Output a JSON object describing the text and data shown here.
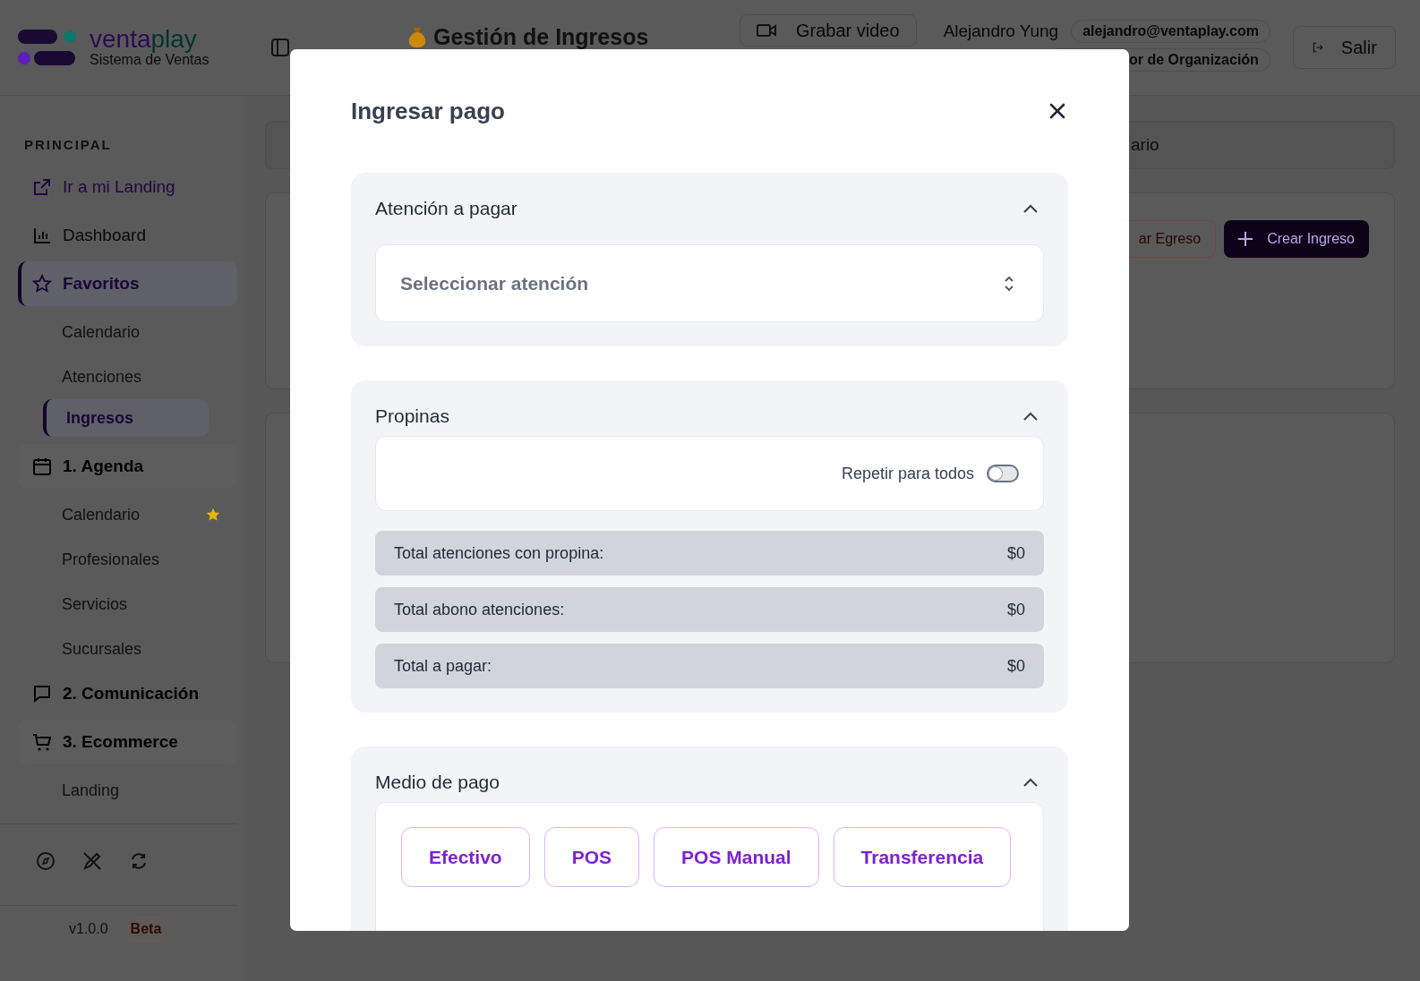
{
  "header": {
    "logo": {
      "brand_first": "venta",
      "brand_second": "play",
      "subtitle": "Sistema de Ventas"
    },
    "page_title": "Gestión de Ingresos",
    "record_button": "Grabar video",
    "user": {
      "name": "Alejandro Yung",
      "email": "alejandro@ventaplay.com",
      "role": "or de Organización"
    },
    "logout_button": "Salir"
  },
  "sidebar": {
    "section_label": "PRINCIPAL",
    "items": [
      {
        "label": "Ir a mi Landing",
        "kind": "link",
        "selected": false
      },
      {
        "label": "Dashboard",
        "kind": "page",
        "selected": false
      },
      {
        "label": "Favoritos",
        "kind": "group",
        "selected": true,
        "children": [
          {
            "label": "Calendario",
            "selected": false,
            "favorite": false
          },
          {
            "label": "Atenciones",
            "selected": false,
            "favorite": false
          },
          {
            "label": "Ingresos",
            "selected": true,
            "favorite": false
          }
        ]
      },
      {
        "label": "1. Agenda",
        "kind": "group",
        "selected": false,
        "children": [
          {
            "label": "Calendario",
            "selected": false,
            "favorite": true
          },
          {
            "label": "Profesionales",
            "selected": false,
            "favorite": false
          },
          {
            "label": "Servicios",
            "selected": false,
            "favorite": false
          },
          {
            "label": "Sucursales",
            "selected": false,
            "favorite": false
          }
        ]
      },
      {
        "label": "2. Comunicación",
        "kind": "group",
        "selected": false
      },
      {
        "label": "3. Ecommerce",
        "kind": "group",
        "selected": false,
        "children": [
          {
            "label": "Landing",
            "selected": false,
            "favorite": false
          }
        ]
      }
    ],
    "version": "v1.0.0",
    "badge": "Beta"
  },
  "main": {
    "search": {
      "placeholder": "ario"
    },
    "actions": [
      {
        "label": "ar Egreso",
        "kind": "outline"
      },
      {
        "label": "Crear Ingreso",
        "kind": "primary"
      }
    ]
  },
  "modal": {
    "title": "Ingresar pago",
    "sections": [
      {
        "title": "Atención a pagar",
        "kind": "select",
        "expanded": true,
        "placeholder": "Seleccionar atención"
      },
      {
        "title": "Propinas",
        "kind": "tips",
        "expanded": true,
        "toggle": {
          "label": "Repetir para todos",
          "on": false
        },
        "totals": [
          {
            "label": "Total atenciones con propina:",
            "value": "$0"
          },
          {
            "label": "Total abono atenciones:",
            "value": "$0"
          },
          {
            "label": "Total a pagar:",
            "value": "$0"
          }
        ]
      },
      {
        "title": "Medio de pago",
        "kind": "methods",
        "expanded": true,
        "methods": [
          {
            "label": "Efectivo",
            "selected": false
          },
          {
            "label": "POS",
            "selected": false
          },
          {
            "label": "POS Manual",
            "selected": false
          },
          {
            "label": "Transferencia",
            "selected": false
          }
        ]
      }
    ]
  }
}
